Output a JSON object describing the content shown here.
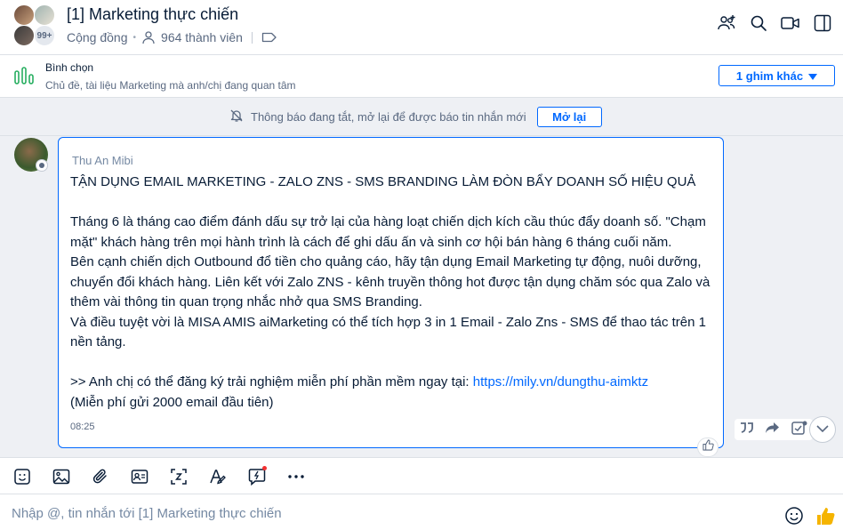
{
  "header": {
    "title": "[1] Marketing thực chiến",
    "community_label": "Cộng đồng",
    "members": "964 thành viên",
    "avatar_overflow": "99+"
  },
  "pinned": {
    "title": "Bình chọn",
    "description": "Chủ đề, tài liệu Marketing mà anh/chị đang quan tâm",
    "more_pins": "1 ghim khác"
  },
  "notice": {
    "text": "Thông báo đang tắt, mở lại để được báo tin nhắn mới",
    "button": "Mở lại"
  },
  "message": {
    "sender": "Thu An Mibi",
    "headline": "TẬN DỤNG EMAIL MARKETING - ZALO ZNS - SMS BRANDING LÀM ĐÒN BẨY DOANH SỐ HIỆU QUẢ",
    "para1": "Tháng 6 là tháng cao điểm đánh dấu sự trở lại của hàng loạt chiến dịch kích cầu thúc đẩy doanh số. \"Chạm mặt\" khách hàng trên mọi hành trình là cách để ghi dấu ấn và sinh cơ hội bán hàng 6 tháng cuối năm.",
    "para2": "Bên cạnh chiến dịch Outbound đổ tiền cho quảng cáo, hãy tận dụng Email Marketing tự động, nuôi dưỡng, chuyển đổi khách hàng. Liên kết với Zalo ZNS - kênh truyền thông hot được tận dụng chăm sóc qua Zalo và thêm vài thông tin quan trọng nhắc nhở qua SMS Branding.",
    "para3": "Và điều tuyệt vời là MISA AMIS aiMarketing có thể tích hợp 3 in 1 Email - Zalo Zns - SMS để thao tác trên 1 nền tảng.",
    "cta_prefix": ">> Anh chị có thể đăng ký trải nghiệm miễn phí phần mềm ngay tại: ",
    "cta_link": "https://mily.vn/dungthu-aimktz",
    "cta_note": "(Miễn phí gửi 2000 email đầu tiên)",
    "time": "08:25"
  },
  "input": {
    "placeholder": "Nhập @, tin nhắn tới [1] Marketing thực chiến"
  },
  "colors": {
    "accent": "#0068ff",
    "chat_bg": "#eef0f4",
    "poll_green": "#27ae60",
    "like_yellow": "#f5b400"
  }
}
